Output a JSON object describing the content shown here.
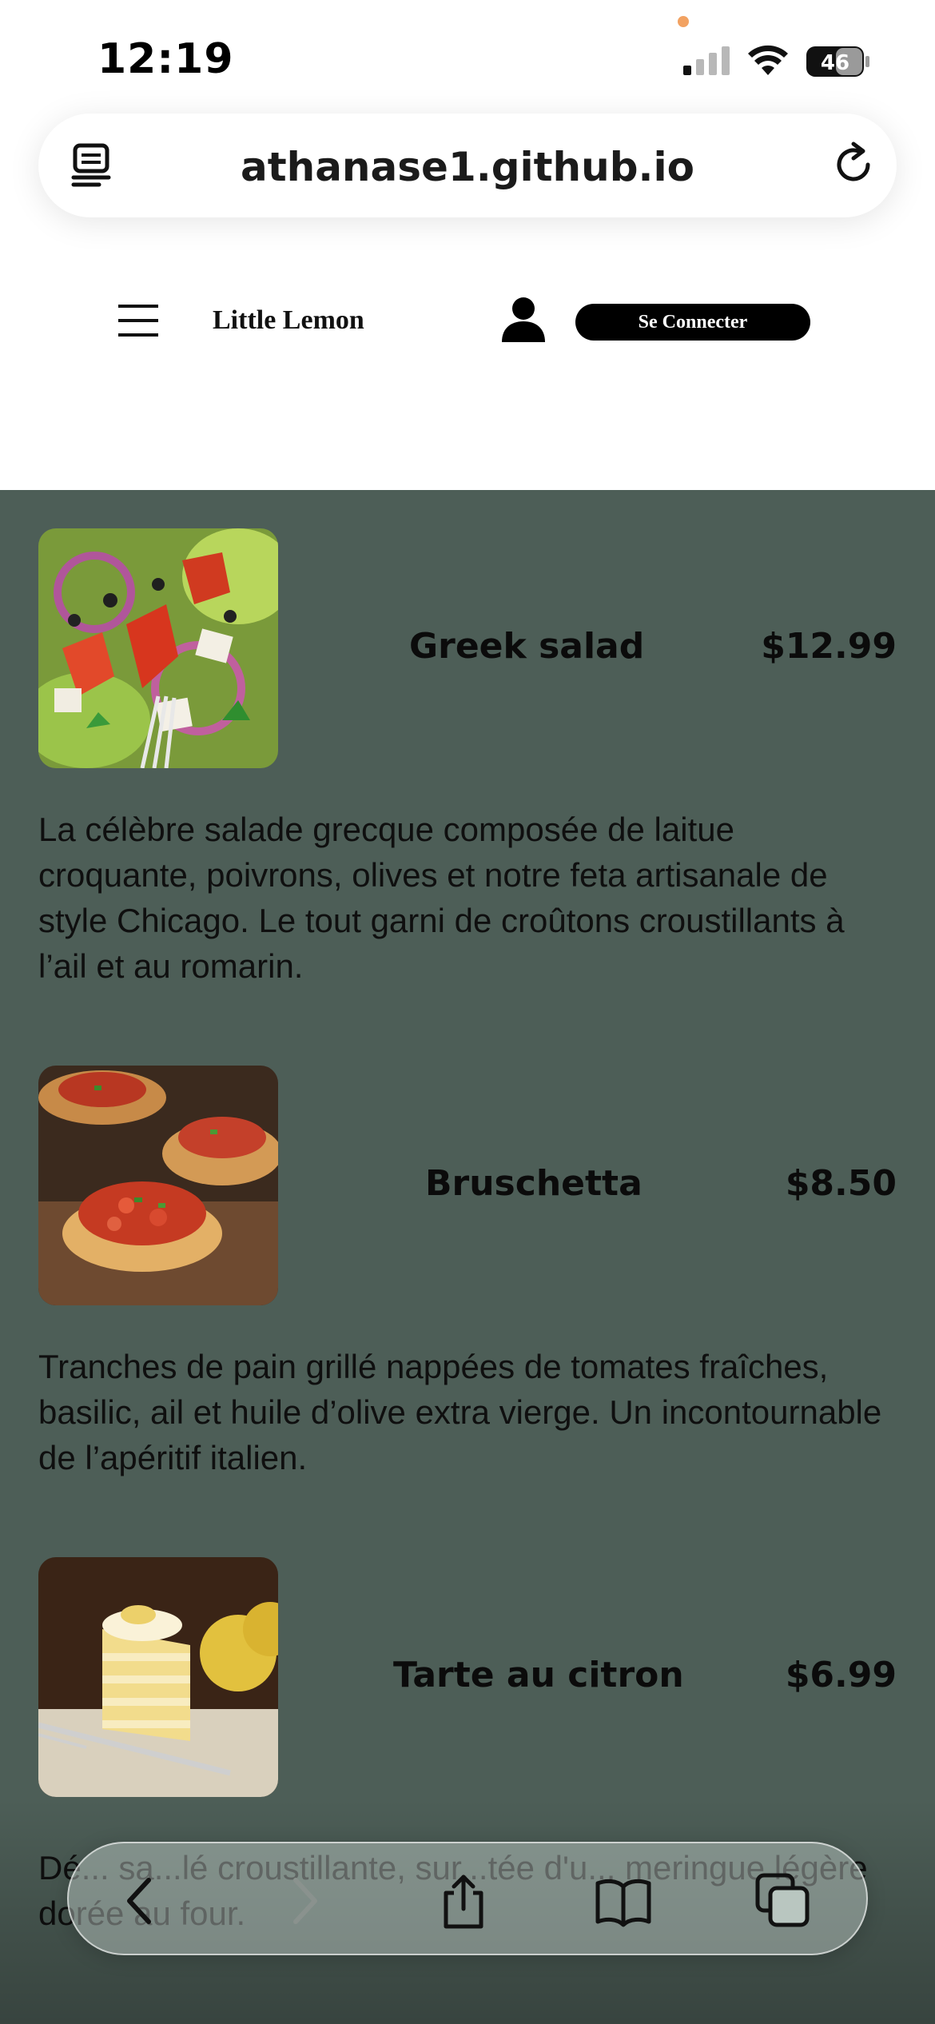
{
  "status_bar": {
    "time": "12:19",
    "battery": "46",
    "privacy_dot_color": "#f2a262"
  },
  "browser": {
    "url": "athanase1.github.io",
    "icons": [
      "reader-icon",
      "reload-icon"
    ]
  },
  "header": {
    "brand": "Little Lemon",
    "login_label": "Se Connecter",
    "icons": [
      "hamburger-menu-icon",
      "user-icon"
    ]
  },
  "menu": {
    "background_color": "#4d5e57",
    "items": [
      {
        "name": "Greek salad",
        "price": "$12.99",
        "image": "greek-salad-photo",
        "description": "La célèbre salade grecque composée de laitue croquante, poivrons, olives et notre feta artisanale de style Chicago. Le tout garni de croûtons croustillants à l’ail et au romarin."
      },
      {
        "name": "Bruschetta",
        "price": "$8.50",
        "image": "bruschetta-photo",
        "description": "Tranches de pain grillé nappées de tomates fraîches, basilic, ail et huile d’olive extra vierge. Un incontournable de l’apéritif italien."
      },
      {
        "name": "Tarte au citron",
        "price": "$6.99",
        "image": "lemon-tart-photo",
        "description": "Dé... sa...lé croustillante, sur...tée d'u... meringue légère dorée au four."
      }
    ]
  },
  "toolbar": {
    "icons": [
      "back-icon",
      "forward-icon",
      "share-icon",
      "bookmarks-icon",
      "tabs-icon"
    ]
  }
}
